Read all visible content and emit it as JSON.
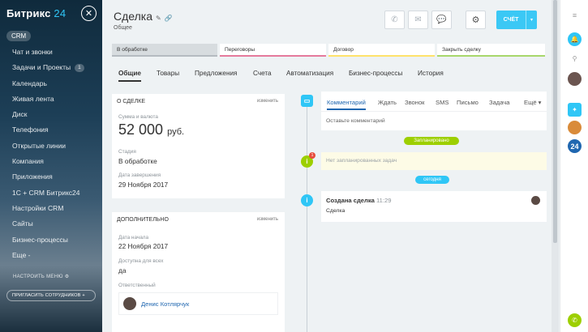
{
  "sidebar": {
    "logo_text": "Битрикс",
    "logo_number": "24",
    "close_glyph": "✕",
    "section": "CRM",
    "items": [
      {
        "label": "Чат и звонки"
      },
      {
        "label": "Задачи и Проекты",
        "count": "1"
      },
      {
        "label": "Календарь"
      },
      {
        "label": "Живая лента"
      },
      {
        "label": "Диск"
      },
      {
        "label": "Телефония"
      },
      {
        "label": "Открытые линии"
      },
      {
        "label": "Компания"
      },
      {
        "label": "Приложения"
      },
      {
        "label": "1С + CRM Битрикс24"
      },
      {
        "label": "Настройки CRM"
      },
      {
        "label": "Сайты"
      },
      {
        "label": "Бизнес-процессы"
      },
      {
        "label": "Еще -"
      }
    ],
    "configure_label": "НАСТРОИТЬ МЕНЮ",
    "invite_label": "ПРИГЛАСИТЬ СОТРУДНИКОВ"
  },
  "header": {
    "title": "Сделка",
    "subtitle": "Общее",
    "invoice_label": "СЧЁТ"
  },
  "stages": [
    {
      "label": "В обработке",
      "color": "#b5bbc0"
    },
    {
      "label": "Переговоры",
      "color": "#e57a9c"
    },
    {
      "label": "Договор",
      "color": "#ffe26b"
    },
    {
      "label": "Закрыть сделку",
      "color": "#a8d76b"
    }
  ],
  "tabs": [
    "Общие",
    "Товары",
    "Предложения",
    "Счета",
    "Автоматизация",
    "Бизнес-процессы",
    "История"
  ],
  "about": {
    "head": "О СДЕЛКЕ",
    "edit": "изменить",
    "amount_label": "Сумма и валюта",
    "amount_value": "52 000",
    "amount_currency": "руб.",
    "stage_label": "Стадия",
    "stage_value": "В обработке",
    "close_label": "Дата завершения",
    "close_value": "29 Ноября 2017"
  },
  "extra": {
    "head": "ДОПОЛНИТЕЛЬНО",
    "edit": "изменить",
    "start_label": "Дата начала",
    "start_value": "22 Ноября 2017",
    "access_label": "Доступна для всех",
    "access_value": "да",
    "resp_label": "Ответственный",
    "resp_value": "Денис Котлярчук"
  },
  "timeline": {
    "editor_tabs": [
      "Комментарий",
      "Ждать",
      "Звонок",
      "SMS",
      "Письмо",
      "Задача",
      "Ещё"
    ],
    "placeholder": "Оставьте комментарий",
    "planned_badge": "Запланировано",
    "no_tasks": "Нет запланированных задач",
    "today_badge": "сегодня",
    "created_title": "Создана сделка",
    "created_time": "11:29",
    "created_text": "Сделка",
    "task_counter": "1"
  },
  "colors": {
    "accent": "#3bc8f5",
    "green": "#9dcf00",
    "timeline_blue": "#2fc6f6"
  }
}
